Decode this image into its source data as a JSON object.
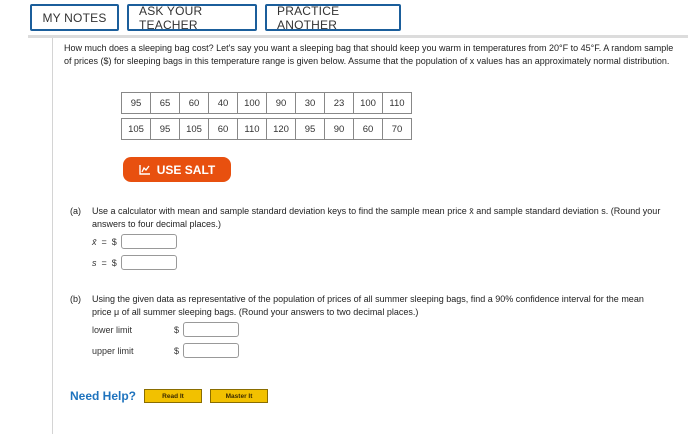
{
  "toolbar": {
    "my_notes": "MY NOTES",
    "ask_teacher": "ASK YOUR TEACHER",
    "practice_another": "PRACTICE ANOTHER"
  },
  "question": {
    "text": "How much does a sleeping bag cost? Let's say you want a sleeping bag that should keep you warm in temperatures from 20°F to 45°F. A random sample of prices ($) for sleeping bags in this temperature range is given below. Assume that the population of x values has an approximately normal distribution."
  },
  "data_table": {
    "rows": [
      [
        "95",
        "65",
        "60",
        "40",
        "100",
        "90",
        "30",
        "23",
        "100",
        "110"
      ],
      [
        "105",
        "95",
        "105",
        "60",
        "110",
        "120",
        "95",
        "90",
        "60",
        "70"
      ]
    ]
  },
  "salt_button": {
    "label": "USE SALT",
    "color": "#e8500f"
  },
  "part_a": {
    "tag": "(a)",
    "text": "Use a calculator with mean and sample standard deviation keys to find the sample mean price x̄ and sample standard deviation s. (Round your answers to four decimal places.)",
    "xbar_label": "x̄",
    "s_label": "s",
    "eq": "=",
    "currency": "$",
    "xbar_value": "",
    "s_value": ""
  },
  "part_b": {
    "tag": "(b)",
    "text": "Using the given data as representative of the population of prices of all summer sleeping bags, find a 90% confidence interval for the mean price μ of all summer sleeping bags. (Round your answers to two decimal places.)",
    "lower_label": "lower limit",
    "upper_label": "upper limit",
    "currency": "$",
    "lower_value": "",
    "upper_value": ""
  },
  "help": {
    "label": "Need Help?",
    "read_it": "Read It",
    "master_it": "Master It"
  },
  "colors": {
    "toolbar_border": "#1b5e9b",
    "help_blue": "#1e73be",
    "help_button": "#f2c100"
  }
}
